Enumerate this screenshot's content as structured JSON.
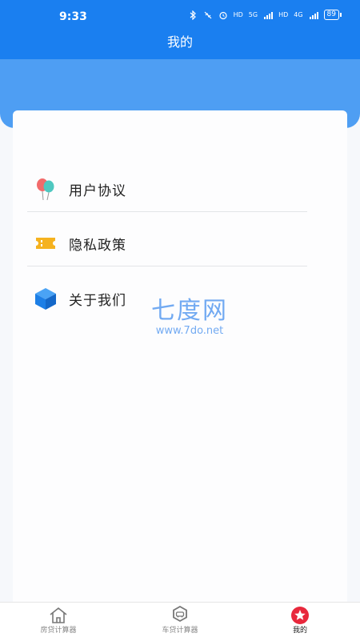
{
  "status_bar": {
    "time": "9:33",
    "network_5g": "5G",
    "network_4g": "4G",
    "hd1": "HD",
    "hd2": "HD",
    "battery": "89"
  },
  "header": {
    "title": "我的"
  },
  "menu": [
    {
      "label": "用户协议",
      "icon": "balloons-icon"
    },
    {
      "label": "隐私政策",
      "icon": "ticket-icon"
    },
    {
      "label": "关于我们",
      "icon": "cube-icon"
    }
  ],
  "watermark": {
    "big": "七度网",
    "small": "www.7do.net"
  },
  "tabbar": {
    "tabs": [
      {
        "label": "房贷计算器",
        "icon": "house-icon"
      },
      {
        "label": "车贷计算器",
        "icon": "car-gear-icon"
      },
      {
        "label": "我的",
        "icon": "star-icon",
        "active": true
      }
    ]
  },
  "colors": {
    "primary": "#1a7ff0",
    "banner": "#4e9ef3",
    "active_tab": "#e8283c"
  }
}
